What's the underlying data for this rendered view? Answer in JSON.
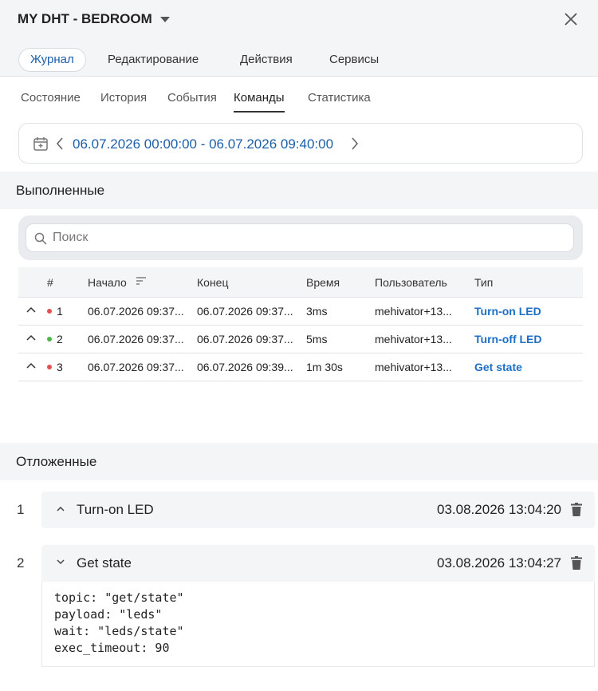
{
  "header": {
    "title": "MY DHT - BEDROOM"
  },
  "main_tabs": [
    {
      "label": "Журнал",
      "active": true
    },
    {
      "label": "Редактирование",
      "active": false
    },
    {
      "label": "Действия",
      "active": false
    },
    {
      "label": "Сервисы",
      "active": false
    }
  ],
  "sub_tabs": [
    {
      "label": "Состояние",
      "active": false
    },
    {
      "label": "История",
      "active": false
    },
    {
      "label": "События",
      "active": false
    },
    {
      "label": "Команды",
      "active": true
    },
    {
      "label": "Статистика",
      "active": false
    }
  ],
  "date_range": {
    "text": "06.07.2026 00:00:00 - 06.07.2026 09:40:00"
  },
  "executed": {
    "title": "Выполненные",
    "search_placeholder": "Поиск",
    "columns": [
      "#",
      "Начало",
      "Конец",
      "Время",
      "Пользователь",
      "Тип"
    ],
    "rows": [
      {
        "num": "1",
        "status_color": "#e05252",
        "start": "06.07.2026 09:37...",
        "end": "06.07.2026 09:37...",
        "duration": "3ms",
        "user": "mehivator+13...",
        "type": "Turn-on LED"
      },
      {
        "num": "2",
        "status_color": "#4cb84c",
        "start": "06.07.2026 09:37...",
        "end": "06.07.2026 09:37...",
        "duration": "5ms",
        "user": "mehivator+13...",
        "type": "Turn-off LED"
      },
      {
        "num": "3",
        "status_color": "#e05252",
        "start": "06.07.2026 09:37...",
        "end": "06.07.2026 09:39...",
        "duration": "1m 30s",
        "user": "mehivator+13...",
        "type": "Get state"
      }
    ]
  },
  "pending": {
    "title": "Отложенные",
    "items": [
      {
        "num": "1",
        "name": "Turn-on LED",
        "date": "03.08.2026 13:04:20",
        "expanded": false
      },
      {
        "num": "2",
        "name": "Get state",
        "date": "03.08.2026 13:04:27",
        "expanded": true,
        "details": [
          "topic: \"get/state\"",
          "payload: \"leds\"",
          "wait: \"leds/state\"",
          "exec_timeout: 90"
        ]
      }
    ]
  },
  "colors": {
    "accent": "#1c5fa8",
    "link": "#1c6fc4",
    "panel": "#f4f5f7"
  },
  "icons": {
    "close": "close-icon",
    "caret": "caret-down-icon",
    "calendar": "calendar-icon",
    "search": "search-icon",
    "sort": "sort-icon",
    "trash": "trash-icon"
  }
}
